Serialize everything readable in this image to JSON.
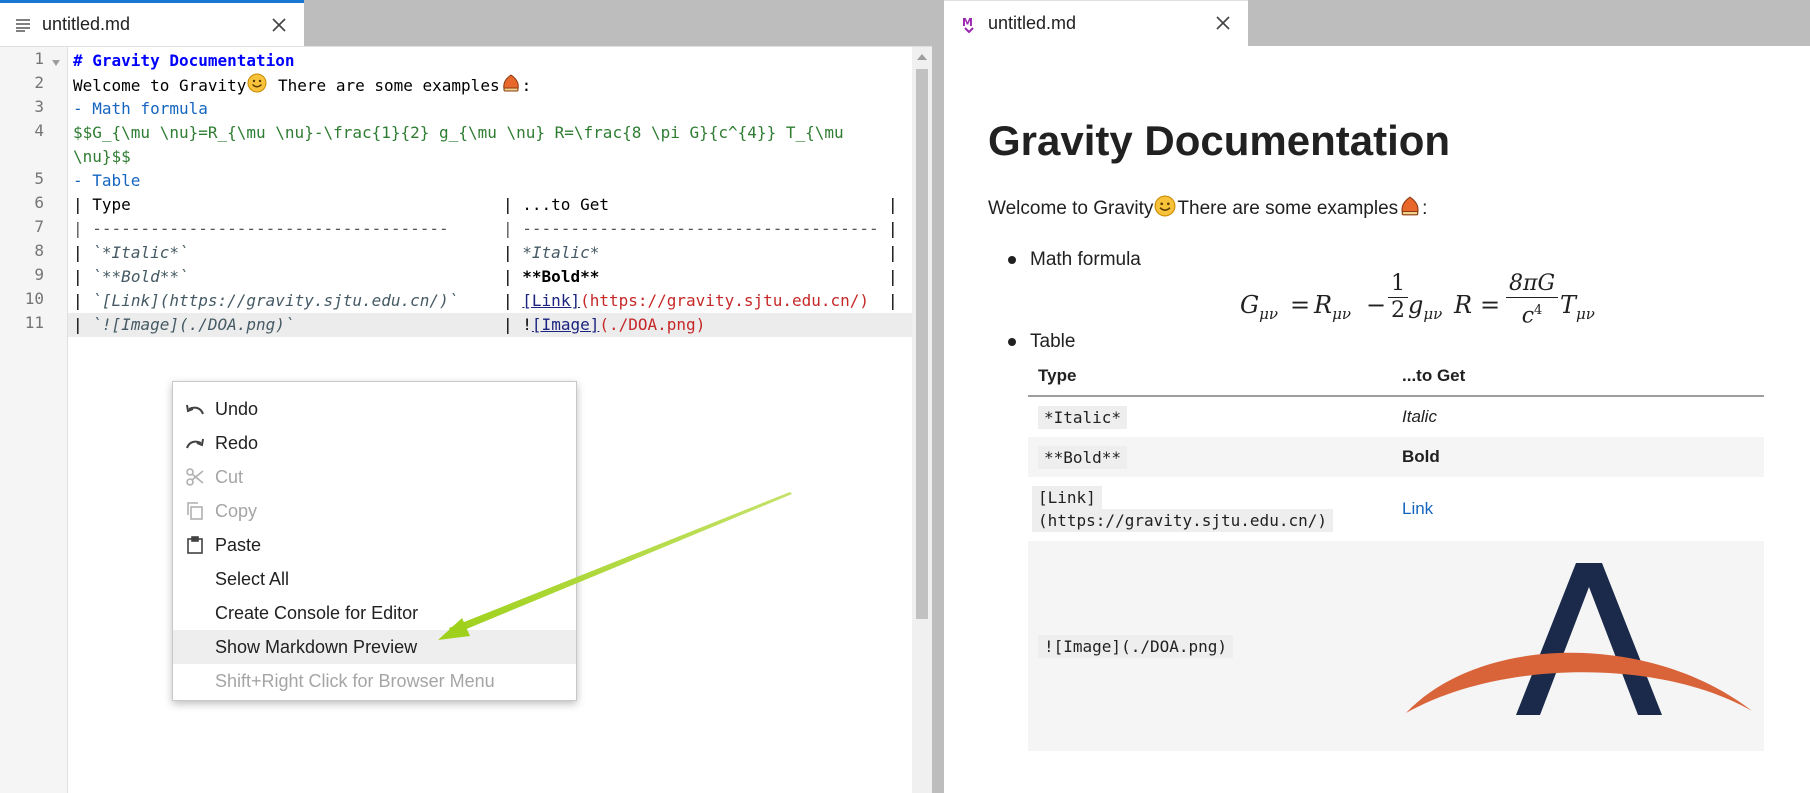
{
  "editor_tab": {
    "label": "untitled.md",
    "icon": "text-file-icon",
    "accent": "#1976d2"
  },
  "preview_tab": {
    "label": "untitled.md",
    "icon": "markdown-icon",
    "accent": "#9c27b0"
  },
  "editor": {
    "line_numbers": [
      "1",
      "2",
      "3",
      "4",
      "",
      "5",
      "6",
      "7",
      "8",
      "9",
      "10",
      "11"
    ],
    "lines": {
      "l1": "# Gravity Documentation",
      "l2a": "Welcome to Gravity",
      "l2b": " There are some examples",
      "l2c": ":",
      "l3": "- Math formula",
      "l4a": "$$G_{\\mu \\nu}=R_{\\mu \\nu}-\\frac{1}{2} g_{\\mu \\nu} R=\\frac{8 \\pi G}{c^{4}} T_{\\mu",
      "l4b": "\\nu}$$",
      "l5": "- Table",
      "l6a": "| Type",
      "l6b": "| ...to Get",
      "l7a": "| -------------------------------------",
      "l7b": "| -------------------------------------",
      "l8a": "`*Italic*`",
      "l8b": "*Italic*",
      "l9a": "`**Bold**`",
      "l9b": "**Bold**",
      "l10a": "`[Link](https://gravity.sjtu.edu.cn/)`",
      "l10b_link": "[Link]",
      "l10b_url": "(https://gravity.sjtu.edu.cn/)",
      "l11a": "`![Image](./DOA.png)`",
      "l11b_bang": "!",
      "l11b_link": "[Image]",
      "l11b_url": "(./DOA.png)",
      "pipe": "|"
    }
  },
  "context_menu": {
    "items": [
      {
        "label": "Undo",
        "icon": "undo-icon",
        "enabled": true
      },
      {
        "label": "Redo",
        "icon": "redo-icon",
        "enabled": true
      },
      {
        "label": "Cut",
        "icon": "scissors-icon",
        "enabled": false
      },
      {
        "label": "Copy",
        "icon": "copy-icon",
        "enabled": false
      },
      {
        "label": "Paste",
        "icon": "clipboard-icon",
        "enabled": true
      },
      {
        "label": "Select All",
        "icon": "",
        "enabled": true
      },
      {
        "label": "Create Console for Editor",
        "icon": "",
        "enabled": true
      },
      {
        "label": "Show Markdown Preview",
        "icon": "",
        "enabled": true,
        "highlighted": true
      },
      {
        "label": "Shift+Right Click for Browser Menu",
        "icon": "",
        "enabled": false
      }
    ]
  },
  "preview": {
    "title": "Gravity Documentation",
    "welcome_a": "Welcome to Gravity",
    "welcome_b": " There are some examples",
    "welcome_c": ":",
    "bullets": [
      "Math formula",
      "Table"
    ],
    "equation_text": "G_{\\mu\\nu} = R_{\\mu\\nu} - \\frac{1}{2} g_{\\mu\\nu} R = \\frac{8\\pi G}{c^4} T_{\\mu\\nu}",
    "eq": {
      "G": "G",
      "R": "R",
      "g": "g",
      "T": "T",
      "R2": "R",
      "munu": "μν",
      "minus": "−",
      "eqs": "=",
      "half_num": "1",
      "half_den": "2",
      "frac_num": "8πG",
      "frac_den": "c",
      "frac_den_exp": "4"
    },
    "table": {
      "headers": [
        "Type",
        "...to Get"
      ],
      "rows": [
        {
          "type": "*Italic*",
          "result": "Italic"
        },
        {
          "type": "**Bold**",
          "result": "Bold"
        },
        {
          "type_a": "[Link]",
          "type_b": "(https://gravity.sjtu.edu.cn/)",
          "result": "Link"
        },
        {
          "type": "![Image](./DOA.png)",
          "result": ""
        }
      ]
    },
    "logo": {
      "letter_color": "#1b2a4a",
      "arc_color": "#d9643a"
    }
  },
  "annotation": {
    "arrow_color": "#a6d62a"
  }
}
